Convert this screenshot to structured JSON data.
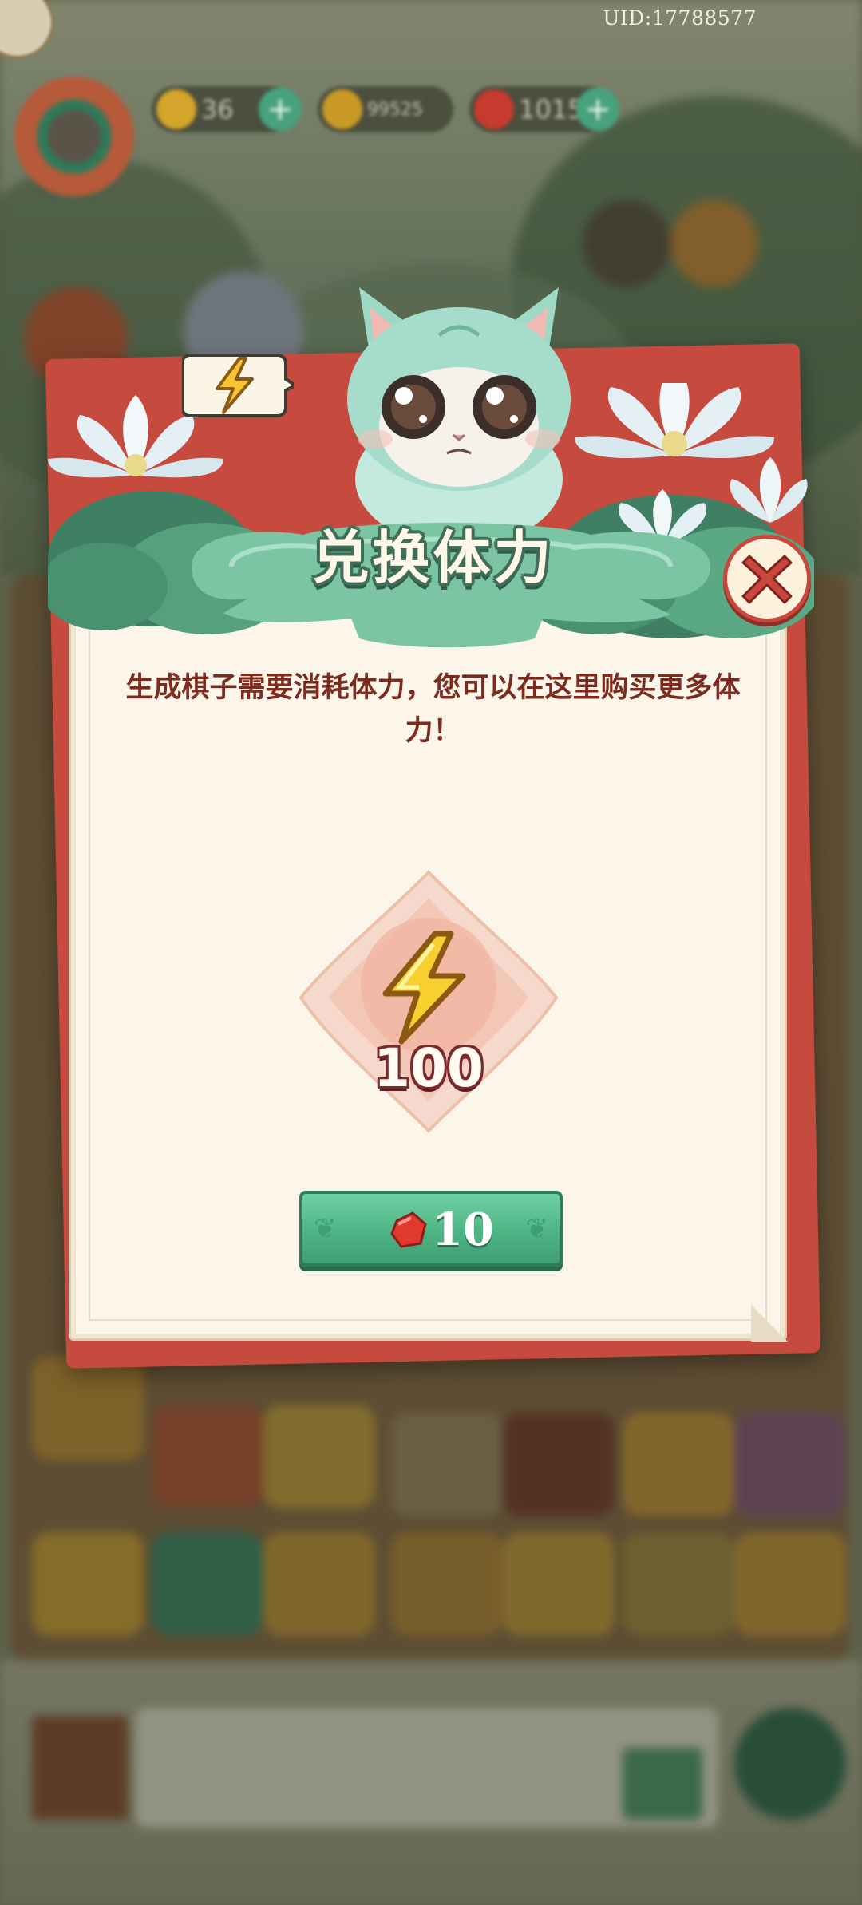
{
  "hud": {
    "uid": "UID:17788577",
    "energy_value": "36",
    "coins_value": "99525",
    "gems_value": "1015",
    "plus_symbol": "+"
  },
  "popup": {
    "title": "兑换体力",
    "description": "生成棋子需要消耗体力，您可以在这里购买更多体力！",
    "reward": {
      "icon": "lightning-icon",
      "amount": "100"
    },
    "buy_button": {
      "currency_icon": "red-gem-icon",
      "price": "10"
    },
    "close_icon": "close-icon"
  },
  "colors": {
    "popup_red": "#c64a3d",
    "paper": "#fbf6e9",
    "text_red": "#7c2b1f",
    "button_green": "#4fb585",
    "title_outline": "#3e6e58"
  }
}
